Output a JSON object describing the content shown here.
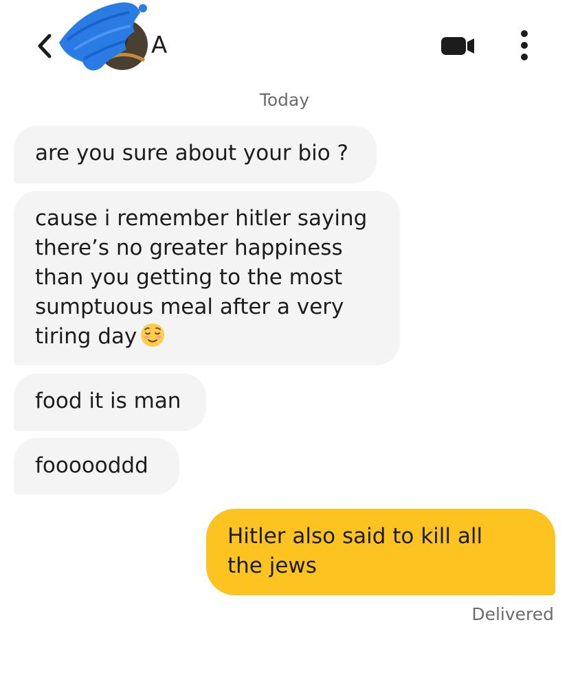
{
  "header": {
    "back_icon": "chevron-left-icon",
    "contact_name": "A",
    "video_icon": "video-camera-icon",
    "more_icon": "more-vertical-icon"
  },
  "conversation": {
    "date_label": "Today",
    "messages": [
      {
        "direction": "incoming",
        "text": "are you sure about your bio ?"
      },
      {
        "direction": "incoming",
        "lines": [
          "cause i remember hitler saying",
          "there’s no greater happiness",
          "than you getting to the most",
          "sumptuous meal after a very",
          "tiring day"
        ],
        "emoji": "relieved-face-emoji"
      },
      {
        "direction": "incoming",
        "text": "food it is man"
      },
      {
        "direction": "incoming",
        "text": "foooooddd"
      },
      {
        "direction": "outgoing",
        "lines": [
          "Hitler also said to kill all",
          "the jews"
        ]
      }
    ],
    "status": "Delivered"
  },
  "colors": {
    "incoming_bubble": "#f4f4f4",
    "outgoing_bubble": "#fcc321",
    "muted_text": "#6b6b6b"
  }
}
